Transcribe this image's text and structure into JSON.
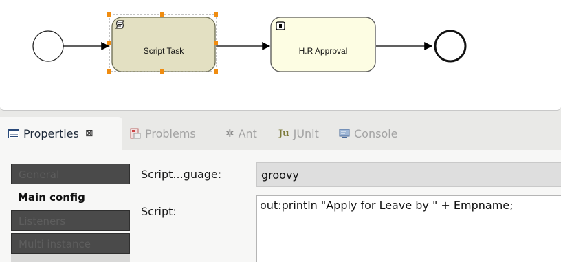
{
  "diagram": {
    "tasks": [
      {
        "label": "Script Task",
        "icon": "script-icon",
        "selected": true
      },
      {
        "label": "H.R Approval",
        "icon": "user-task-icon",
        "selected": false
      }
    ],
    "colors": {
      "script_task_fill": "#e3e0c2",
      "approval_task_fill": "#fdfde3",
      "selection_handle": "#f08c10",
      "edge": "#000000"
    }
  },
  "tabs": [
    {
      "label": "Properties",
      "icon": "properties-icon",
      "active": true,
      "close_symbol": "⊠"
    },
    {
      "label": "Problems",
      "icon": "problems-icon",
      "active": false
    },
    {
      "label": "Ant",
      "icon": "ant-icon",
      "active": false
    },
    {
      "label": "JUnit",
      "icon": "junit-icon",
      "icon_text": "Ju",
      "active": false
    },
    {
      "label": "Console",
      "icon": "console-icon",
      "active": false
    }
  ],
  "sidenav": [
    {
      "label": "General",
      "selected": false
    },
    {
      "label": "Main config",
      "selected": true
    },
    {
      "label": "Listeners",
      "selected": false
    },
    {
      "label": "Multi instance",
      "selected": false
    }
  ],
  "fields": {
    "script_language": {
      "label": "Script...guage:",
      "value": "groovy"
    },
    "script": {
      "label": "Script:",
      "value": "out:println \"Apply for Leave by \" + Empname;"
    }
  }
}
